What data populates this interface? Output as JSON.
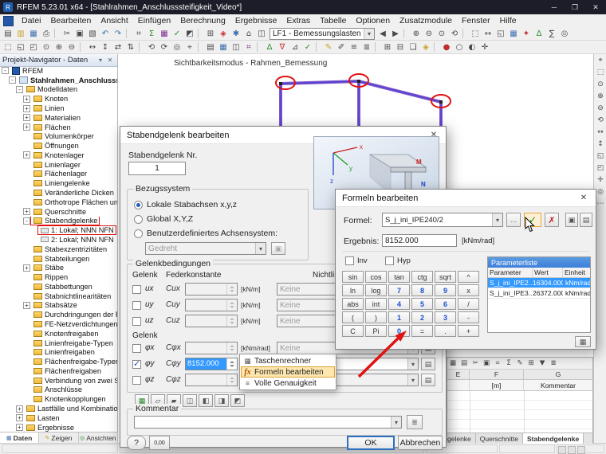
{
  "colors": {
    "titlebar": "#1d1d29",
    "selection": "#3399ff",
    "annotation": "#e01212",
    "member": "#8a56c8",
    "member_core": "#4343d6",
    "param_header": "#3d7edb",
    "menu_highlight": "#fde7ae",
    "accent": "#2e6fc0"
  },
  "titlebar": {
    "title": "RFEM 5.23.01 x64 - [Stahlrahmen_Anschlusssteifigkeit_Video*]",
    "app_glyph": "R",
    "buttons": [
      {
        "g": "─"
      },
      {
        "g": "❐"
      },
      {
        "g": "✕"
      }
    ]
  },
  "menubar": {
    "items": [
      {
        "label": "Datei"
      },
      {
        "label": "Bearbeiten"
      },
      {
        "label": "Ansicht"
      },
      {
        "label": "Einfügen"
      },
      {
        "label": "Berechnung"
      },
      {
        "label": "Ergebnisse"
      },
      {
        "label": "Extras"
      },
      {
        "label": "Tabelle"
      },
      {
        "label": "Optionen"
      },
      {
        "label": "Zusatzmodule"
      },
      {
        "label": "Fenster"
      },
      {
        "label": "Hilfe"
      }
    ]
  },
  "toolbar_main": {
    "load_case": "LF1 - Bemessungslasten",
    "icons_left": [
      {
        "g": "▤"
      },
      {
        "g": "▥",
        "c": "#c9a227"
      },
      {
        "g": "▦",
        "c": "#3a6fb0"
      },
      {
        "g": "⎙"
      },
      {
        "sep": true
      },
      {
        "g": "✂"
      },
      {
        "g": "▣"
      },
      {
        "g": "▧"
      },
      {
        "g": "↶",
        "c": "#3a6fb0"
      },
      {
        "g": "↷",
        "c": "#3a6fb0"
      },
      {
        "sep": true
      },
      {
        "g": "⌗"
      },
      {
        "g": "Σ",
        "c": "#2e8b2e"
      },
      {
        "g": "▦",
        "c": "#7a2e8b"
      },
      {
        "g": "✓",
        "c": "#2e8b2e"
      },
      {
        "g": "◩"
      },
      {
        "sep": true
      },
      {
        "g": "⊞"
      },
      {
        "g": "◈",
        "c": "#c03030"
      },
      {
        "g": "✱",
        "c": "#3a6fb0"
      },
      {
        "g": "⌂"
      },
      {
        "g": "◫"
      }
    ],
    "icons_right": [
      {
        "g": "◀"
      },
      {
        "g": "▶"
      },
      {
        "sep": true
      },
      {
        "g": "⊕"
      },
      {
        "g": "⊖"
      },
      {
        "g": "⊙"
      },
      {
        "g": "⟲"
      },
      {
        "sep": true
      },
      {
        "g": "⬚"
      },
      {
        "g": "↔"
      },
      {
        "g": "◱"
      },
      {
        "g": "▦",
        "c": "#3a6fb0"
      },
      {
        "g": "✦",
        "c": "#c03030"
      },
      {
        "g": "Δ",
        "c": "#2e8b2e"
      },
      {
        "g": "∑"
      },
      {
        "g": "◎"
      }
    ]
  },
  "toolbar_second": {
    "icons": [
      {
        "g": "⬚"
      },
      {
        "g": "◱"
      },
      {
        "g": "◰"
      },
      {
        "g": "⊙"
      },
      {
        "g": "⊕"
      },
      {
        "g": "⊖"
      },
      {
        "sep": true
      },
      {
        "g": "↔"
      },
      {
        "g": "↕"
      },
      {
        "g": "⇄"
      },
      {
        "g": "⇅"
      },
      {
        "sep": true
      },
      {
        "g": "⟲"
      },
      {
        "g": "⟳"
      },
      {
        "g": "◎"
      },
      {
        "g": "⌖"
      },
      {
        "sep": true
      },
      {
        "g": "▤"
      },
      {
        "g": "▦",
        "c": "#3a6fb0"
      },
      {
        "g": "◫"
      },
      {
        "g": "⌗",
        "c": "#7a2e8b"
      },
      {
        "sep": true
      },
      {
        "g": "Δ",
        "c": "#2e8b2e"
      },
      {
        "g": "∇",
        "c": "#c03030"
      },
      {
        "g": "⊿"
      },
      {
        "g": "✓",
        "c": "#2e8b2e"
      },
      {
        "sep": true
      },
      {
        "g": "✎",
        "c": "#c9a227"
      },
      {
        "g": "✐"
      },
      {
        "g": "≡"
      },
      {
        "g": "≣"
      },
      {
        "sep": true
      },
      {
        "g": "⊞"
      },
      {
        "g": "⊟"
      },
      {
        "g": "❏"
      },
      {
        "g": "◈",
        "c": "#c9a227"
      },
      {
        "sep": true
      },
      {
        "g": "●",
        "c": "#c03030"
      },
      {
        "g": "○"
      },
      {
        "g": "◐"
      },
      {
        "g": "✛"
      }
    ]
  },
  "right_toolbar": {
    "icons": [
      {
        "g": "⌖"
      },
      {
        "g": "⬚"
      },
      {
        "g": "⊙"
      },
      {
        "g": "⊕"
      },
      {
        "g": "⊖"
      },
      {
        "g": "⟲"
      },
      {
        "g": "↔"
      },
      {
        "g": "↕"
      },
      {
        "g": "◱"
      },
      {
        "g": "◰"
      },
      {
        "g": "✛"
      },
      {
        "g": "◎"
      },
      {
        "g": "⋯"
      }
    ]
  },
  "navigator": {
    "title": "Projekt-Navigator - Daten",
    "menu_glyph": "▾",
    "close_glyph": "✕",
    "tree": [
      {
        "label": "RFEM",
        "depth": 0,
        "exp": "-",
        "icon": "app"
      },
      {
        "label": "Stahlrahmen_Anschlusssteifigkeit_Video*",
        "depth": 1,
        "exp": "-",
        "icon": "model",
        "bold": true
      },
      {
        "label": "Modelldaten",
        "depth": 2,
        "exp": "-",
        "icon": "folder"
      },
      {
        "label": "Knoten",
        "depth": 3,
        "exp": "+",
        "icon": "folder"
      },
      {
        "label": "Linien",
        "depth": 3,
        "exp": "+",
        "icon": "folder"
      },
      {
        "label": "Materialien",
        "depth": 3,
        "exp": "+",
        "icon": "folder"
      },
      {
        "label": "Flächen",
        "depth": 3,
        "exp": "+",
        "icon": "folder"
      },
      {
        "label": "Volumenkörper",
        "depth": 3,
        "icon": "folder"
      },
      {
        "label": "Öffnungen",
        "depth": 3,
        "icon": "folder"
      },
      {
        "label": "Knotenlager",
        "depth": 3,
        "exp": "+",
        "icon": "folder"
      },
      {
        "label": "Linienlager",
        "depth": 3,
        "icon": "folder"
      },
      {
        "label": "Flächenlager",
        "depth": 3,
        "icon": "folder"
      },
      {
        "label": "Liniengelenke",
        "depth": 3,
        "icon": "folder"
      },
      {
        "label": "Veränderliche Dicken",
        "depth": 3,
        "icon": "folder"
      },
      {
        "label": "Orthotrope Flächen und Steifen",
        "depth": 3,
        "icon": "folder"
      },
      {
        "label": "Querschnitte",
        "depth": 3,
        "exp": "+",
        "icon": "folder"
      },
      {
        "label": "Stabendgelenke",
        "depth": 3,
        "exp": "-",
        "icon": "folder",
        "red": true
      },
      {
        "label": "1: Lokal; NNN NFN",
        "depth": 4,
        "icon": "hinge",
        "red": true
      },
      {
        "label": "2: Lokal; NNN NFN",
        "depth": 4,
        "icon": "hinge"
      },
      {
        "label": "Stabexzentrizitäten",
        "depth": 3,
        "icon": "folder"
      },
      {
        "label": "Stabteilungen",
        "depth": 3,
        "icon": "folder"
      },
      {
        "label": "Stäbe",
        "depth": 3,
        "exp": "+",
        "icon": "folder"
      },
      {
        "label": "Rippen",
        "depth": 3,
        "icon": "folder"
      },
      {
        "label": "Stabbettungen",
        "depth": 3,
        "icon": "folder"
      },
      {
        "label": "Stabnichtlinearitäten",
        "depth": 3,
        "icon": "folder"
      },
      {
        "label": "Stabsätze",
        "depth": 3,
        "exp": "+",
        "icon": "folder"
      },
      {
        "label": "Durchdringungen der Flächen",
        "depth": 3,
        "icon": "folder"
      },
      {
        "label": "FE-Netzverdichtungen",
        "depth": 3,
        "icon": "folder"
      },
      {
        "label": "Knotenfreigaben",
        "depth": 3,
        "icon": "folder"
      },
      {
        "label": "Linienfreigabe-Typen",
        "depth": 3,
        "icon": "folder"
      },
      {
        "label": "Linienfreigaben",
        "depth": 3,
        "icon": "folder"
      },
      {
        "label": "Flächenfreigabe-Typen",
        "depth": 3,
        "icon": "folder"
      },
      {
        "label": "Flächenfreigaben",
        "depth": 3,
        "icon": "folder"
      },
      {
        "label": "Verbindung von zwei Stäben",
        "depth": 3,
        "icon": "folder"
      },
      {
        "label": "Anschlüsse",
        "depth": 3,
        "icon": "folder"
      },
      {
        "label": "Knotenkopplungen",
        "depth": 3,
        "icon": "folder"
      },
      {
        "label": "Lastfälle und Kombinationen",
        "depth": 2,
        "exp": "+",
        "icon": "folder"
      },
      {
        "label": "Lasten",
        "depth": 2,
        "exp": "+",
        "icon": "folder"
      },
      {
        "label": "Ergebnisse",
        "depth": 2,
        "exp": "+",
        "icon": "folder"
      }
    ],
    "tabs": [
      {
        "label": "Daten",
        "g": "▦",
        "c": "#3a6fb0",
        "active": true
      },
      {
        "label": "Zeigen",
        "g": "✎",
        "c": "#c9a227"
      },
      {
        "label": "Ansichten",
        "g": "◎",
        "c": "#2e8b2e"
      }
    ]
  },
  "canvas": {
    "mode_label": "Sichtbarkeitsmodus - Rahmen_Bemessung"
  },
  "hinge_dialog": {
    "title": "Stabendgelenk bearbeiten",
    "close_glyph": "✕",
    "number_label": "Stabendgelenk Nr.",
    "number_value": "1",
    "image": {
      "x": "x",
      "y": "y",
      "z": "z",
      "m": "M",
      "n": "N"
    },
    "reference": {
      "group_label": "Bezugssystem",
      "options": [
        {
          "label": "Lokale Stabachsen x,y,z",
          "selected": true
        },
        {
          "label": "Global X,Y,Z"
        },
        {
          "label": "Benutzerdefiniertes Achsensystem:"
        }
      ],
      "axis_value": "Gedreht",
      "axis_button_glyph": "▣"
    },
    "conditions": {
      "group_label": "Gelenkbedingungen",
      "header_gelenk": "Gelenk",
      "header_feder": "Federkonstante",
      "header_nichtlin": "Nichtlin.",
      "header_gelenk2": "Gelenk",
      "rows_u": [
        {
          "dof": "ux",
          "c_label": "Cux",
          "unit": "[kN/m]",
          "nonlin": "Keine"
        },
        {
          "dof": "uy",
          "c_label": "Cuy",
          "unit": "[kN/m]",
          "nonlin": "Keine"
        },
        {
          "dof": "uz",
          "c_label": "Cuz",
          "unit": "[kN/m]",
          "nonlin": "Keine"
        }
      ],
      "rows_phi": [
        {
          "dof": "φx",
          "c_label": "Cφx",
          "unit": "[kNm/rad]",
          "nonlin": "Keine"
        },
        {
          "dof": "φy",
          "c_label": "Cφy",
          "unit": "[kNm/rad]",
          "nonlin": "Keine",
          "checked": true,
          "value": "8152.000"
        },
        {
          "dof": "φz",
          "c_label": "Cφz",
          "unit": "[kNm/rad]",
          "nonlin": "Keine"
        }
      ],
      "presets": [
        {
          "g": "▦",
          "c": "#2e8b2e"
        },
        {
          "g": "▱"
        },
        {
          "g": "▰"
        },
        {
          "g": "◫"
        },
        {
          "g": "◧"
        },
        {
          "g": "◨"
        },
        {
          "g": "◩"
        }
      ]
    },
    "comment": {
      "group_label": "Kommentar",
      "button_glyph": "≣"
    },
    "buttons": {
      "help": "?",
      "units": "0,00",
      "ok": "OK",
      "cancel": "Abbrechen"
    }
  },
  "context_menu": {
    "items": [
      {
        "label": "Taschenrechner",
        "glyph": "▦",
        "ic": "calc"
      },
      {
        "label": "Formeln bearbeiten",
        "glyph": "fx",
        "ic": "fx",
        "highlighted": true
      },
      {
        "label": "Volle Genauigkeit",
        "glyph": "≡",
        "ic": "prec"
      }
    ]
  },
  "formula_dialog": {
    "title": "Formeln bearbeiten",
    "close_glyph": "✕",
    "formula_label": "Formel:",
    "formula_value": "S_j_ini_IPE240/2",
    "buttons": {
      "dots": "…",
      "apply": "✓",
      "delete": "✗",
      "copy": "▣",
      "save": "▤",
      "params_edit": "▦"
    },
    "result_label": "Ergebnis:",
    "result_value": "8152.000",
    "result_unit": "[kNm/rad]",
    "inv_label": "Inv",
    "hyp_label": "Hyp",
    "keys": [
      {
        "t": "sin"
      },
      {
        "t": "cos"
      },
      {
        "t": "tan"
      },
      {
        "t": "ctg"
      },
      {
        "t": "sqrt"
      },
      {
        "t": "^"
      },
      {
        "t": "ln"
      },
      {
        "t": "log"
      },
      {
        "t": "7",
        "num": true
      },
      {
        "t": "8",
        "num": true
      },
      {
        "t": "9",
        "num": true
      },
      {
        "t": "x"
      },
      {
        "t": "abs"
      },
      {
        "t": "int"
      },
      {
        "t": "4",
        "num": true
      },
      {
        "t": "5",
        "num": true
      },
      {
        "t": "6",
        "num": true
      },
      {
        "t": "/"
      },
      {
        "t": "("
      },
      {
        "t": ")"
      },
      {
        "t": "1",
        "num": true
      },
      {
        "t": "2",
        "num": true
      },
      {
        "t": "3",
        "num": true
      },
      {
        "t": "-"
      },
      {
        "t": "C"
      },
      {
        "t": "Pi"
      },
      {
        "t": "0",
        "num": true
      },
      {
        "t": "="
      },
      {
        "t": "."
      },
      {
        "t": "+"
      }
    ],
    "param_title": "Parameterliste",
    "param_columns": [
      "Parameter",
      "Wert",
      "Einheit"
    ],
    "params": [
      {
        "name": "S_j_ini_IPE2...",
        "value": "16304.000",
        "unit": "kNm/rad",
        "selected": true
      },
      {
        "name": "S_j_ini_IPE3...",
        "value": "26372.000",
        "unit": "kNm/rad"
      }
    ]
  },
  "table_panel": {
    "toolbar_icons": [
      {
        "g": "▦"
      },
      {
        "g": "▤"
      },
      {
        "g": "✂"
      },
      {
        "g": "▣"
      },
      {
        "g": "⌗"
      },
      {
        "g": "Σ"
      },
      {
        "g": "✎"
      },
      {
        "g": "⊞"
      },
      {
        "g": "▼"
      },
      {
        "g": "≣"
      }
    ],
    "col_letters": [
      "E",
      "F",
      "G"
    ],
    "col_units": [
      "",
      "[m]",
      "Kommentar"
    ],
    "tabs": [
      {
        "label": "gelenke",
        "frag": true
      },
      {
        "label": "Querschnitte"
      },
      {
        "label": "Stabendgelenke",
        "active": true
      }
    ]
  }
}
